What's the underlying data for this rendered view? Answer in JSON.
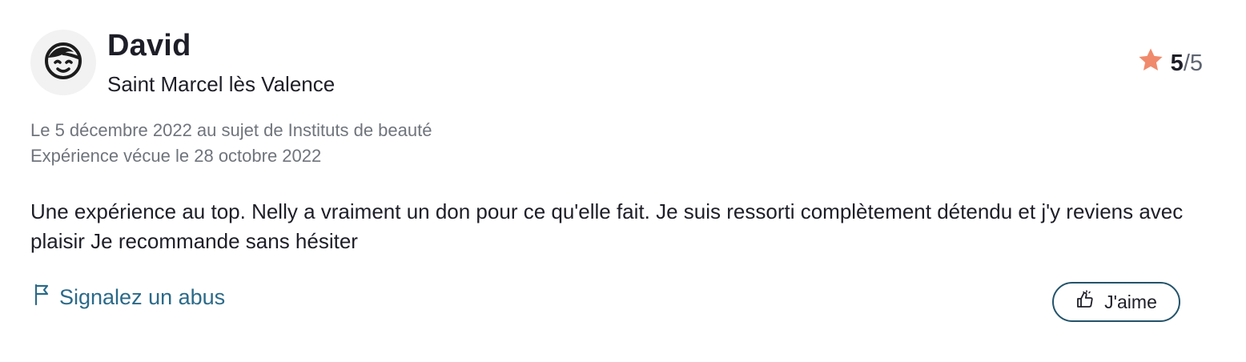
{
  "review": {
    "author": {
      "name": "David",
      "location": "Saint Marcel lès Valence",
      "avatar_icon": "face-icon"
    },
    "rating": {
      "score": "5",
      "separator_max": "/5",
      "star_color": "#f08a6c",
      "icon": "star-icon"
    },
    "meta": {
      "date_line": "Le 5 décembre 2022 au sujet de Instituts de beauté",
      "experience_line": "Expérience vécue le 28 octobre 2022"
    },
    "text": "Une expérience au top. Nelly a vraiment un don pour ce qu'elle fait. Je suis ressorti complètement détendu et j'y reviens avec plaisir Je recommande sans hésiter",
    "actions": {
      "report_label": "Signalez un abus",
      "report_icon": "flag-icon",
      "like_label": "J'aime",
      "like_icon": "thumbs-up-icon"
    }
  },
  "colors": {
    "link": "#2b6a89",
    "button_border": "#23536b",
    "muted_text": "#6f747c",
    "star": "#f08a6c"
  }
}
